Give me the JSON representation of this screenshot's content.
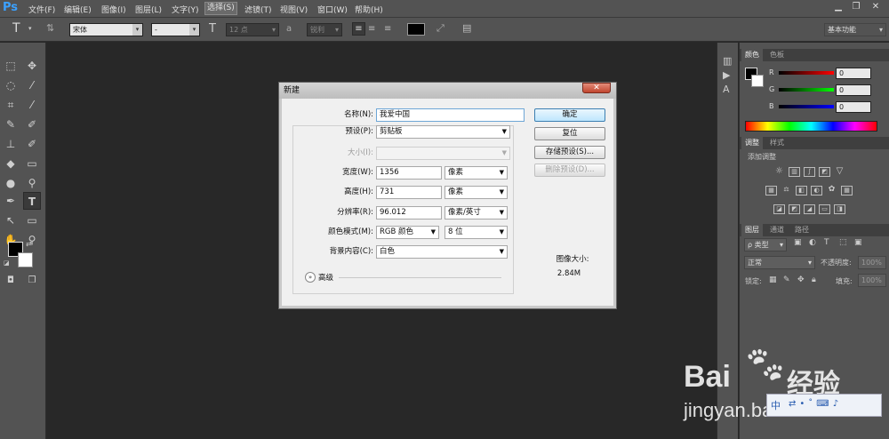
{
  "app": {
    "logo": "Ps"
  },
  "menubar": {
    "items": [
      "文件(F)",
      "编辑(E)",
      "图像(I)",
      "图层(L)",
      "文字(Y)",
      "选择(S)",
      "滤镜(T)",
      "视图(V)",
      "窗口(W)",
      "帮助(H)"
    ],
    "active_index": 5
  },
  "options_bar": {
    "font_family": "宋体",
    "font_style": "-",
    "font_size": "12 点",
    "aa_icon": "a",
    "aa_method": "锐利",
    "workspace": "基本功能"
  },
  "panels": {
    "color": {
      "tabs": [
        "颜色",
        "色板"
      ],
      "r_label": "R",
      "g_label": "G",
      "b_label": "B",
      "r": "0",
      "g": "0",
      "b": "0"
    },
    "adjustments": {
      "tabs": [
        "调整",
        "样式"
      ],
      "title": "添加调整"
    },
    "layers": {
      "tabs": [
        "图层",
        "通道",
        "路径"
      ],
      "filter_label": "ρ 类型",
      "blend_mode": "正常",
      "opacity_label": "不透明度:",
      "opacity_value": "100%",
      "lock_label": "锁定:",
      "fill_label": "填充:",
      "fill_value": "100%"
    }
  },
  "dialog": {
    "title": "新建",
    "close_label": "✕",
    "name_label": "名称(N):",
    "name_value": "我爱中国",
    "preset_label": "预设(P):",
    "preset_value": "剪贴板",
    "size_label": "大小(I):",
    "width_label": "宽度(W):",
    "width_value": "1356",
    "width_unit": "像素",
    "height_label": "高度(H):",
    "height_value": "731",
    "height_unit": "像素",
    "resolution_label": "分辨率(R):",
    "resolution_value": "96.012",
    "resolution_unit": "像素/英寸",
    "color_mode_label": "颜色模式(M):",
    "color_mode_value": "RGB 颜色",
    "bit_depth": "8 位",
    "background_label": "背景内容(C):",
    "background_value": "白色",
    "advanced_label": "高级",
    "buttons": {
      "ok": "确定",
      "reset": "复位",
      "save_preset": "存储预设(S)...",
      "delete_preset": "删除预设(D)..."
    },
    "image_size_label": "图像大小:",
    "image_size_value": "2.84M"
  },
  "watermark": {
    "brand": "Bai",
    "brand2": "经验",
    "url": "jingyan.baidu.com"
  }
}
